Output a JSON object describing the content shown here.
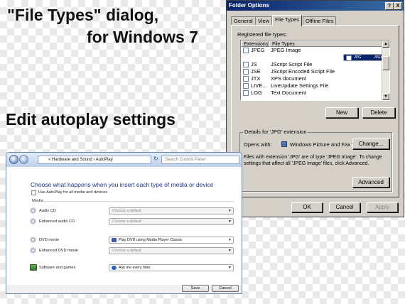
{
  "headings": {
    "line1": "\"File Types\" dialog,",
    "line2": "for Windows 7",
    "line3": "Edit autoplay settings"
  },
  "folder_options": {
    "title": "Folder Options",
    "title_buttons": [
      "?",
      "X"
    ],
    "tabs": [
      "General",
      "View",
      "File Types",
      "Offline Files"
    ],
    "active_tab": "File Types",
    "registered_label": "Registered file types:",
    "columns": [
      "Extensions",
      "File Types"
    ],
    "rows": [
      {
        "ext": "JPEG",
        "type": "JPEG Image",
        "selected": false
      },
      {
        "ext": "JPG",
        "type": "JPEG Image",
        "selected": true
      },
      {
        "ext": "JS",
        "type": "JScript Script File",
        "selected": false
      },
      {
        "ext": "JSE",
        "type": "JScript Encoded Script File",
        "selected": false
      },
      {
        "ext": "JTX",
        "type": "XPS document",
        "selected": false
      },
      {
        "ext": "LIVE...",
        "type": "LiveUpdate Settings File",
        "selected": false
      },
      {
        "ext": "LOG",
        "type": "Text Document",
        "selected": false
      }
    ],
    "new_button": "New",
    "delete_button": "Delete",
    "details_title": "Details for 'JPG' extension",
    "opens_with_label": "Opens with:",
    "opens_with_app": "Windows Picture and Fax V",
    "change_button": "Change...",
    "description_line1": "Files with extension 'JPG' are of type 'JPEG Image'.  To change",
    "description_line2": "settings that affect all 'JPEG Image' files, click Advanced.",
    "advanced_button": "Advanced",
    "ok_button": "OK",
    "cancel_button": "Cancel",
    "apply_button": "Apply",
    "colors": {
      "title_bar": "#0a246a",
      "face": "#d4d0c8",
      "selection": "#0a246a"
    }
  },
  "autoplay": {
    "breadcrumb_prefix": "«",
    "breadcrumb_parent": "Hardware and Sound",
    "breadcrumb_sep": "›",
    "breadcrumb_current": "AutoPlay",
    "search_placeholder": "Search Control Panel",
    "heading": "Choose what happens when you insert each type of media or device",
    "use_autoplay_label": "Use AutoPlay for all media and devices",
    "media_section": "Media",
    "items": [
      {
        "label": "Audio CD",
        "value": "Choose a default"
      },
      {
        "label": "Enhanced audio CD",
        "value": "Choose a default"
      },
      {
        "label": "DVD movie",
        "value": "Play DVD using Media Player Classic"
      },
      {
        "label": "Enhanced DVD movie",
        "value": "Choose a default"
      },
      {
        "label": "Software and games",
        "value": "Ask me every time"
      }
    ],
    "save_button": "Save",
    "cancel_button": "Cancel",
    "colors": {
      "frame": "#c3d5ee",
      "heading": "#1e3287"
    }
  }
}
